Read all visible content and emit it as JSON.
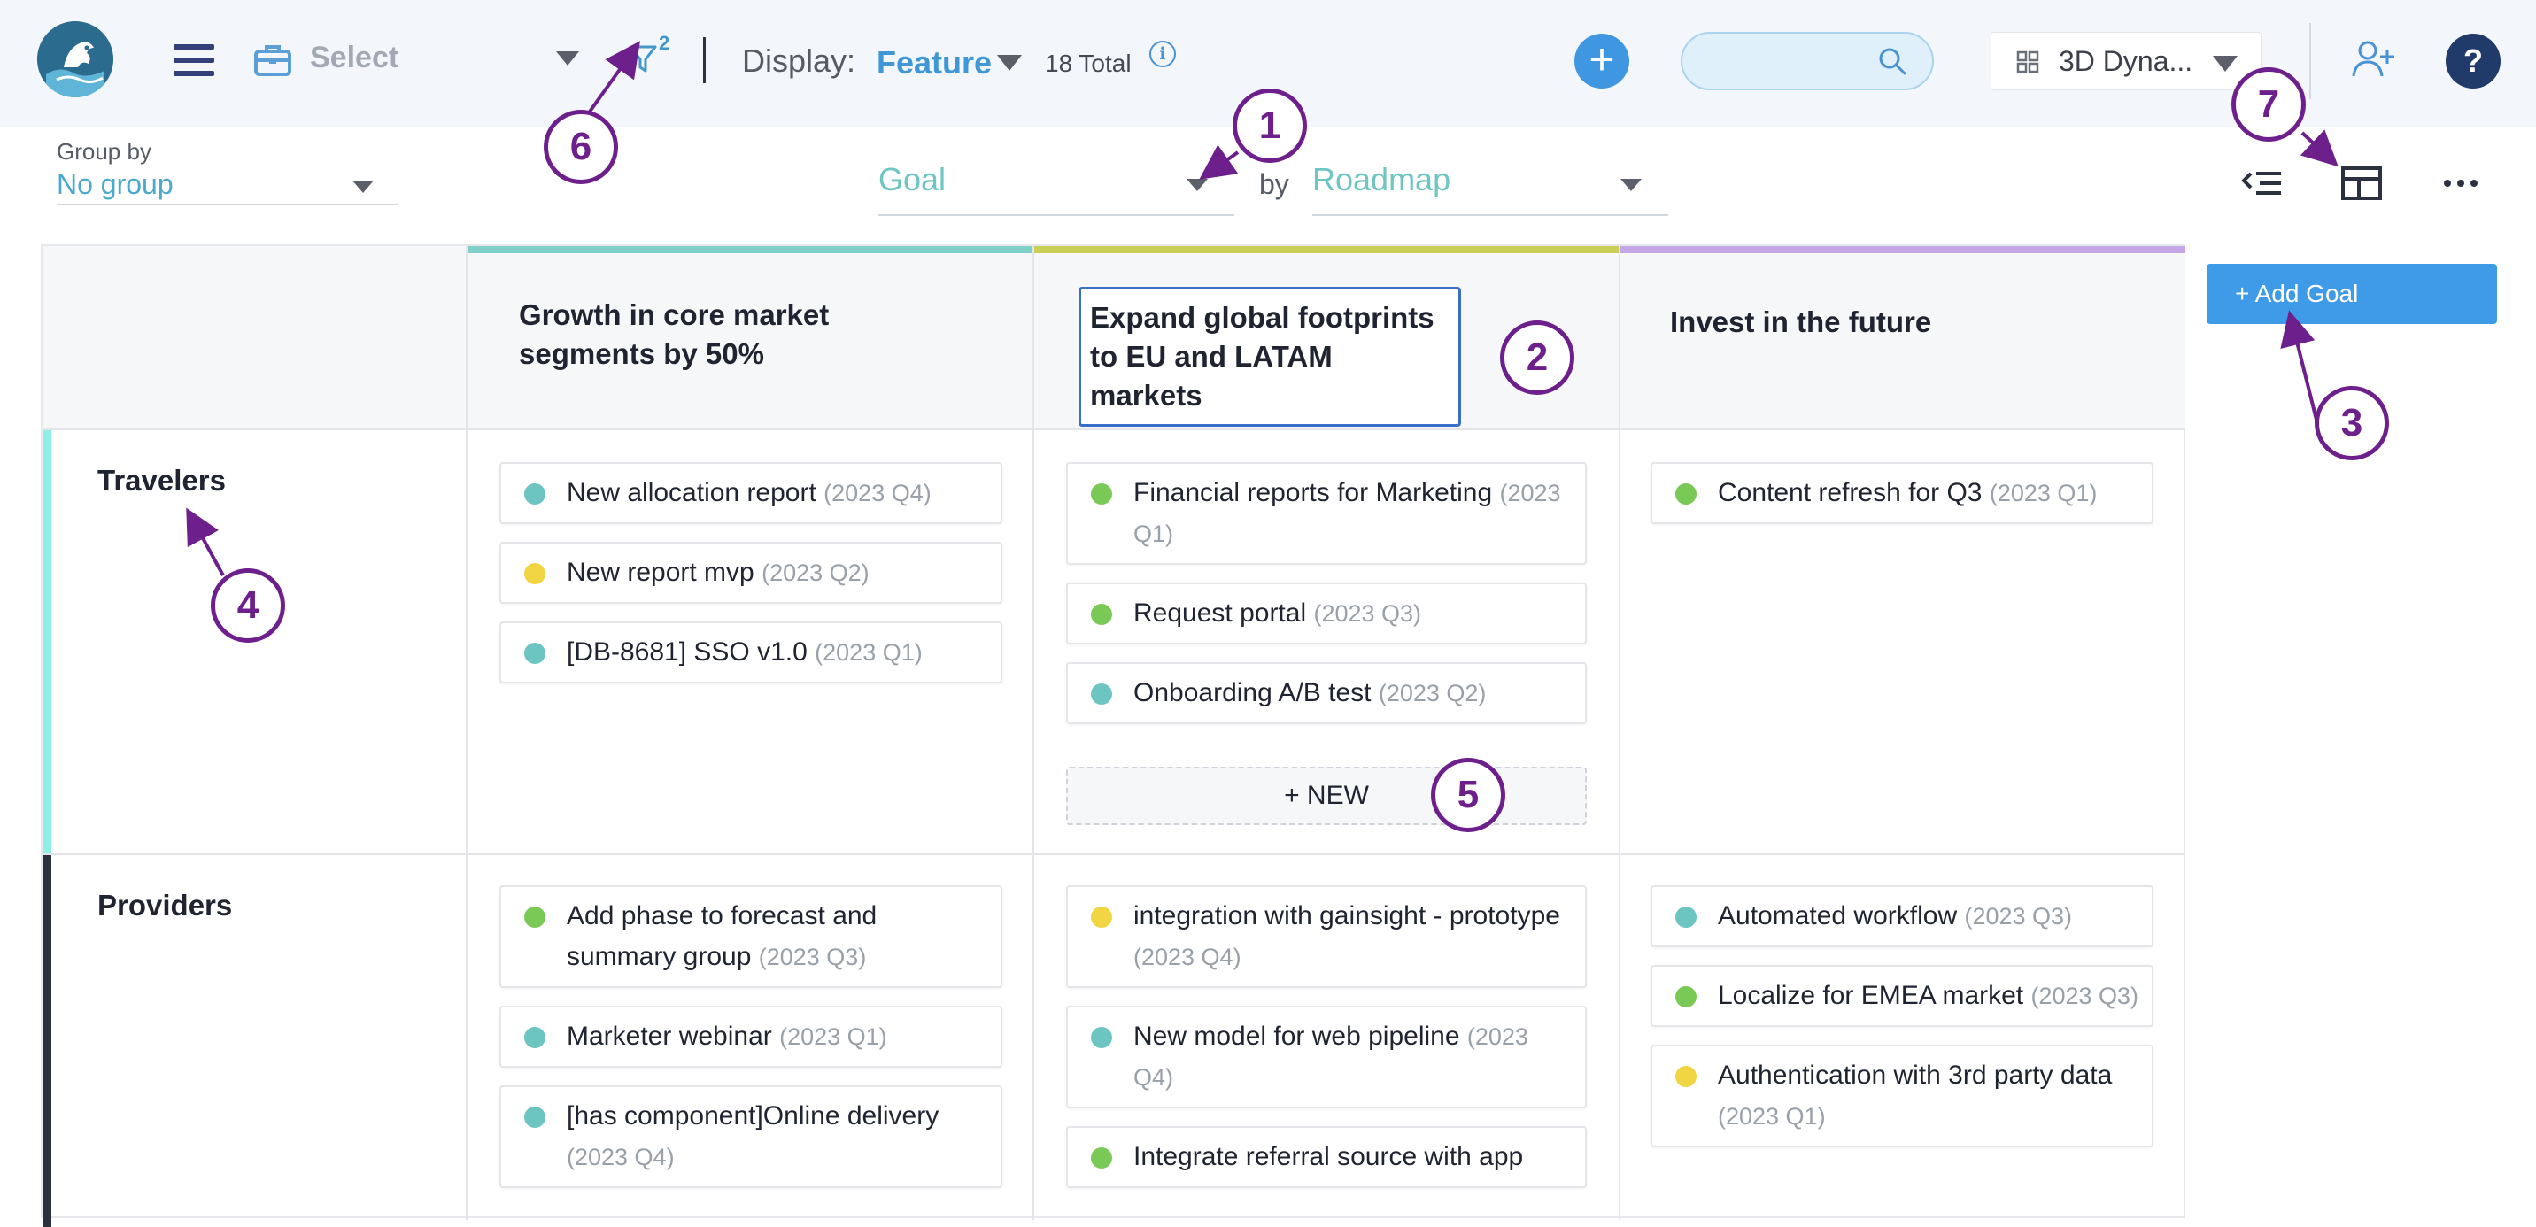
{
  "topbar": {
    "workspace_placeholder": "Select",
    "filter_count": "2",
    "display_label": "Display:",
    "display_value": "Feature",
    "total": "18 Total",
    "info": "i",
    "add": "+",
    "search_placeholder": "",
    "project": "3D Dyna...",
    "help": "?"
  },
  "toolbar": {
    "groupby_label": "Group by",
    "groupby_value": "No group",
    "goal_select": "Goal",
    "by": "by",
    "roadmap_select": "Roadmap"
  },
  "columns": [
    {
      "title": "Growth in core market segments by 50%",
      "color": "#7fd0c9"
    },
    {
      "title": "Expand global footprints to EU and LATAM markets",
      "color": "#c9cf55"
    },
    {
      "title": "Invest in the future",
      "color": "#c5a6e6"
    }
  ],
  "lanes": [
    {
      "name": "Travelers",
      "accent": "#8ef0e4",
      "cells": [
        [
          {
            "text": "New allocation report",
            "q": "(2023 Q4)",
            "dot": "teal"
          },
          {
            "text": "New report mvp",
            "q": "(2023 Q2)",
            "dot": "yellow"
          },
          {
            "text": "[DB-8681] SSO v1.0",
            "q": "(2023 Q1)",
            "dot": "teal"
          }
        ],
        [
          {
            "text": "Financial reports for Marketing",
            "q": "(2023 Q1)",
            "dot": "green"
          },
          {
            "text": "Request portal",
            "q": "(2023 Q3)",
            "dot": "green"
          },
          {
            "text": "Onboarding A/B test",
            "q": "(2023 Q2)",
            "dot": "teal"
          }
        ],
        [
          {
            "text": "Content refresh for Q3",
            "q": "(2023 Q1)",
            "dot": "green"
          }
        ]
      ]
    },
    {
      "name": "Providers",
      "accent": "#2c3140",
      "cells": [
        [
          {
            "text": "Add phase to forecast and summary group",
            "q": "(2023 Q3)",
            "dot": "green"
          },
          {
            "text": "Marketer webinar",
            "q": "(2023 Q1)",
            "dot": "teal"
          },
          {
            "text": "[has component]Online delivery",
            "q": "(2023 Q4)",
            "dot": "teal"
          }
        ],
        [
          {
            "text": "integration with gainsight - prototype",
            "q": "(2023 Q4)",
            "dot": "yellow"
          },
          {
            "text": "New model for web pipeline",
            "q": "(2023 Q4)",
            "dot": "teal"
          },
          {
            "text": "Integrate referral source with app",
            "q": "",
            "dot": "green"
          }
        ],
        [
          {
            "text": "Automated workflow",
            "q": "(2023 Q3)",
            "dot": "teal"
          },
          {
            "text": "Localize for EMEA market",
            "q": "(2023 Q3)",
            "dot": "green"
          },
          {
            "text": "Authentication with 3rd party data",
            "q": "(2023 Q1)",
            "dot": "yellow"
          }
        ]
      ]
    }
  ],
  "new_button": "+ NEW",
  "add_goal": "+ Add Goal",
  "dot_colors": {
    "teal": "#6cc5c1",
    "green": "#7ac956",
    "yellow": "#f2d542"
  },
  "annotations": [
    "1",
    "2",
    "3",
    "4",
    "5",
    "6",
    "7"
  ]
}
